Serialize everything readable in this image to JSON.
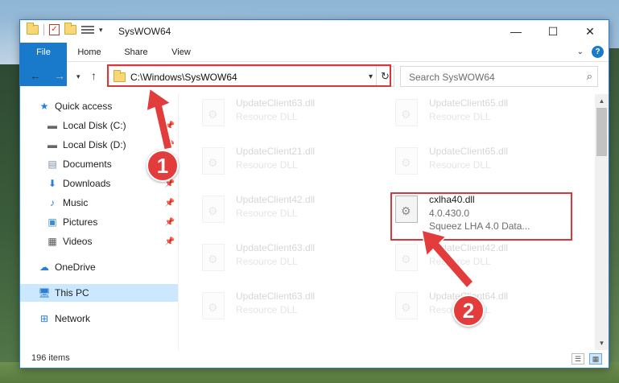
{
  "window": {
    "title": "SysWOW64",
    "minimize": "—",
    "maximize": "☐",
    "close": "✕"
  },
  "ribbon": {
    "tabs": [
      "File",
      "Home",
      "Share",
      "View"
    ],
    "help": "?"
  },
  "nav": {
    "address": "C:\\Windows\\SysWOW64",
    "search_placeholder": "Search SysWOW64"
  },
  "sidebar": {
    "items": [
      {
        "label": "Quick access",
        "icon": "star-icon"
      },
      {
        "label": "Local Disk (C:)",
        "icon": "drive-icon",
        "pinned": true
      },
      {
        "label": "Local Disk (D:)",
        "icon": "drive-icon",
        "pinned": true
      },
      {
        "label": "Documents",
        "icon": "documents-icon",
        "pinned": true
      },
      {
        "label": "Downloads",
        "icon": "downloads-icon",
        "pinned": true
      },
      {
        "label": "Music",
        "icon": "music-icon",
        "pinned": true
      },
      {
        "label": "Pictures",
        "icon": "pictures-icon",
        "pinned": true
      },
      {
        "label": "Videos",
        "icon": "videos-icon",
        "pinned": true
      },
      {
        "label": "OneDrive",
        "icon": "cloud-icon"
      },
      {
        "label": "This PC",
        "icon": "computer-icon",
        "selected": true
      },
      {
        "label": "Network",
        "icon": "network-icon"
      }
    ]
  },
  "files": [
    {
      "name": "UpdateClient63.dll",
      "line2": "Resource DLL",
      "line3": ""
    },
    {
      "name": "UpdateClient65.dll",
      "line2": "Resource DLL",
      "line3": ""
    },
    {
      "name": "UpdateClient21.dll",
      "line2": "Resource DLL",
      "line3": ""
    },
    {
      "name": "UpdateClient65.dll",
      "line2": "Resource DLL",
      "line3": ""
    },
    {
      "name": "UpdateClient42.dll",
      "line2": "Resource DLL",
      "line3": ""
    },
    {
      "name": "cxlha40.dll",
      "line2": "4.0.430.0",
      "line3": "Squeez LHA 4.0 Data..."
    },
    {
      "name": "UpdateClient63.dll",
      "line2": "Resource DLL",
      "line3": ""
    },
    {
      "name": "UpdateClient42.dll",
      "line2": "Resource DLL",
      "line3": ""
    },
    {
      "name": "UpdateClient63.dll",
      "line2": "Resource DLL",
      "line3": ""
    },
    {
      "name": "UpdateClient64.dll",
      "line2": "Resource DLL",
      "line3": ""
    }
  ],
  "status": {
    "items_count": "196 items"
  },
  "callouts": [
    "1",
    "2"
  ],
  "colors": {
    "accent": "#1979ca",
    "highlight": "#d9363e",
    "selected_bg": "#cce8ff"
  }
}
